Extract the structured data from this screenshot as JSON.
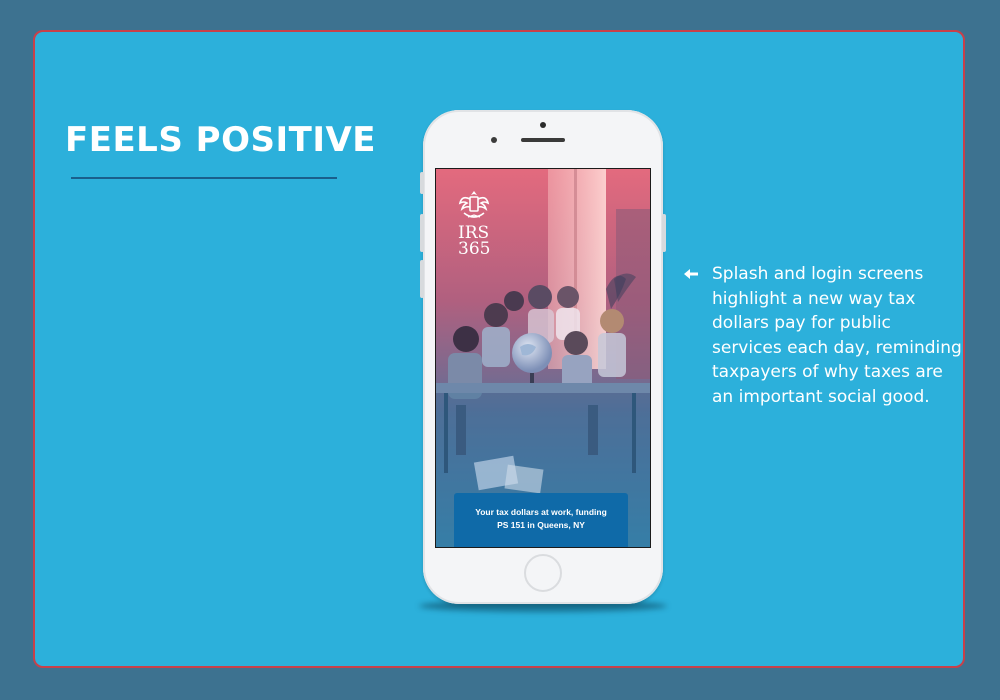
{
  "slide": {
    "title": "FEELS POSITIVE",
    "annotation_lines": [
      "Splash and login screens",
      "highlight a new way tax",
      "dollars pay for public",
      "services each day, reminding",
      "taxpayers of why taxes are",
      "an important social good."
    ]
  },
  "phone_screen": {
    "logo_lines": [
      "IRS",
      "365"
    ],
    "banner_lines": [
      "Your tax dollars at work, funding",
      "PS 151 in Queens, NY"
    ]
  },
  "icons": {
    "logo": "irs-eagle-icon",
    "annotation_pointer": "arrow-left-icon"
  },
  "colors": {
    "page_background": "#3d7290",
    "slide_background": "#2cb0db",
    "slide_border": "#c8404a",
    "title_rule": "#1a5f8c",
    "banner": "#0f6aa8"
  }
}
